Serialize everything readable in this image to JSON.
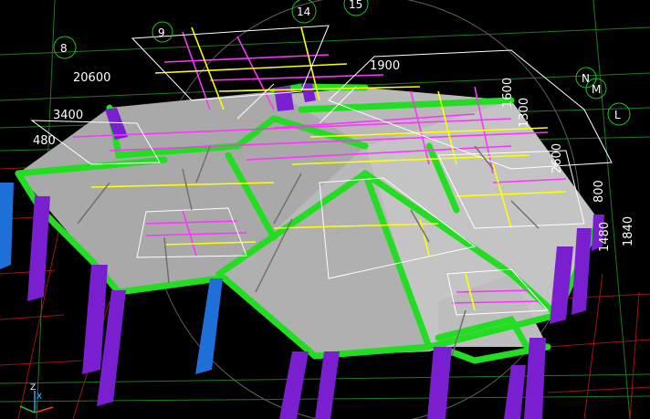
{
  "viewport": {
    "grid_bubbles": [
      {
        "id": "bubble-14",
        "label": "14"
      },
      {
        "id": "bubble-15",
        "label": "15"
      },
      {
        "id": "bubble-9",
        "label": "9"
      },
      {
        "id": "bubble-8",
        "label": "8"
      },
      {
        "id": "bubble-N",
        "label": "N"
      },
      {
        "id": "bubble-M",
        "label": "M"
      },
      {
        "id": "bubble-L",
        "label": "L"
      }
    ],
    "dimensions": {
      "d20600": "20600",
      "d3400": "3400",
      "d480": "480",
      "d1900": "1900",
      "d1600": "1600",
      "d1300": "1300",
      "d2600": "2600",
      "d800": "800",
      "d1480": "1480",
      "d1840": "1840"
    },
    "axes": {
      "z": "Z",
      "x": "X"
    },
    "colors": {
      "slab": "#b4b4b4",
      "beam": "#22dd22",
      "column_purple": "#7a1fd0",
      "column_blue": "#1f6fd8",
      "rebar_magenta": "#ff33ff",
      "rebar_yellow": "#ffff00",
      "grid_red": "#b01010",
      "grid_green": "#1f8f1f"
    }
  }
}
